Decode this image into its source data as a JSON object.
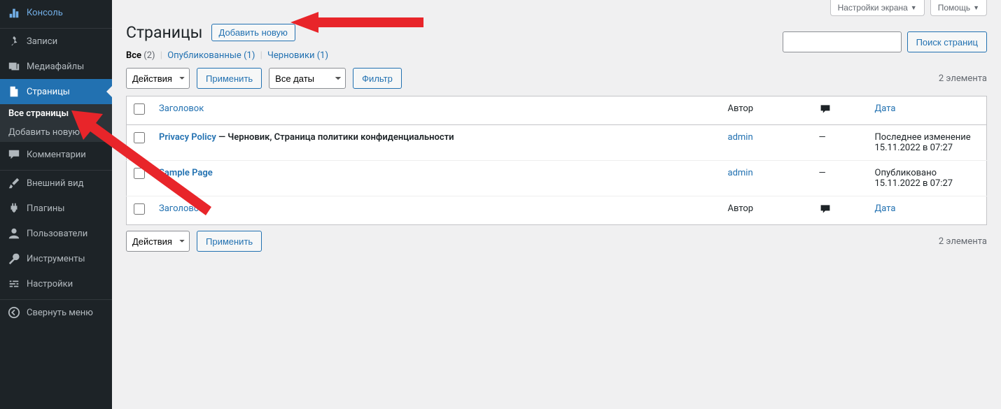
{
  "topbar": {
    "screen_options": "Настройки экрана",
    "help": "Помощь"
  },
  "sidebar": {
    "items": [
      {
        "id": "dashboard",
        "label": "Консоль"
      },
      {
        "id": "posts",
        "label": "Записи"
      },
      {
        "id": "media",
        "label": "Медиафайлы"
      },
      {
        "id": "pages",
        "label": "Страницы"
      },
      {
        "id": "comments",
        "label": "Комментарии"
      },
      {
        "id": "appearance",
        "label": "Внешний вид"
      },
      {
        "id": "plugins",
        "label": "Плагины"
      },
      {
        "id": "users",
        "label": "Пользователи"
      },
      {
        "id": "tools",
        "label": "Инструменты"
      },
      {
        "id": "settings",
        "label": "Настройки"
      },
      {
        "id": "collapse",
        "label": "Свернуть меню"
      }
    ],
    "submenu": {
      "all_pages": "Все страницы",
      "add_new": "Добавить новую"
    }
  },
  "heading": {
    "title": "Страницы",
    "add_new": "Добавить новую"
  },
  "filters": {
    "all_label": "Все",
    "all_count": "(2)",
    "published_label": "Опубликованные",
    "published_count": "(1)",
    "drafts_label": "Черновики",
    "drafts_count": "(1)"
  },
  "bulk": {
    "actions": "Действия",
    "apply": "Применить",
    "all_dates": "Все даты",
    "filter": "Фильтр"
  },
  "count_text": "2 элемента",
  "search": {
    "button": "Поиск страниц"
  },
  "table": {
    "columns": {
      "title": "Заголовок",
      "author": "Автор",
      "date": "Дата"
    },
    "rows": [
      {
        "title": "Privacy Policy",
        "state": "— Черновик, Страница политики конфиденциальности",
        "author": "admin",
        "comments": "—",
        "date_label": "Последнее изменение",
        "date_value": "15.11.2022 в 07:27"
      },
      {
        "title": "Sample Page",
        "state": "",
        "author": "admin",
        "comments": "—",
        "date_label": "Опубликовано",
        "date_value": "15.11.2022 в 07:27"
      }
    ]
  }
}
